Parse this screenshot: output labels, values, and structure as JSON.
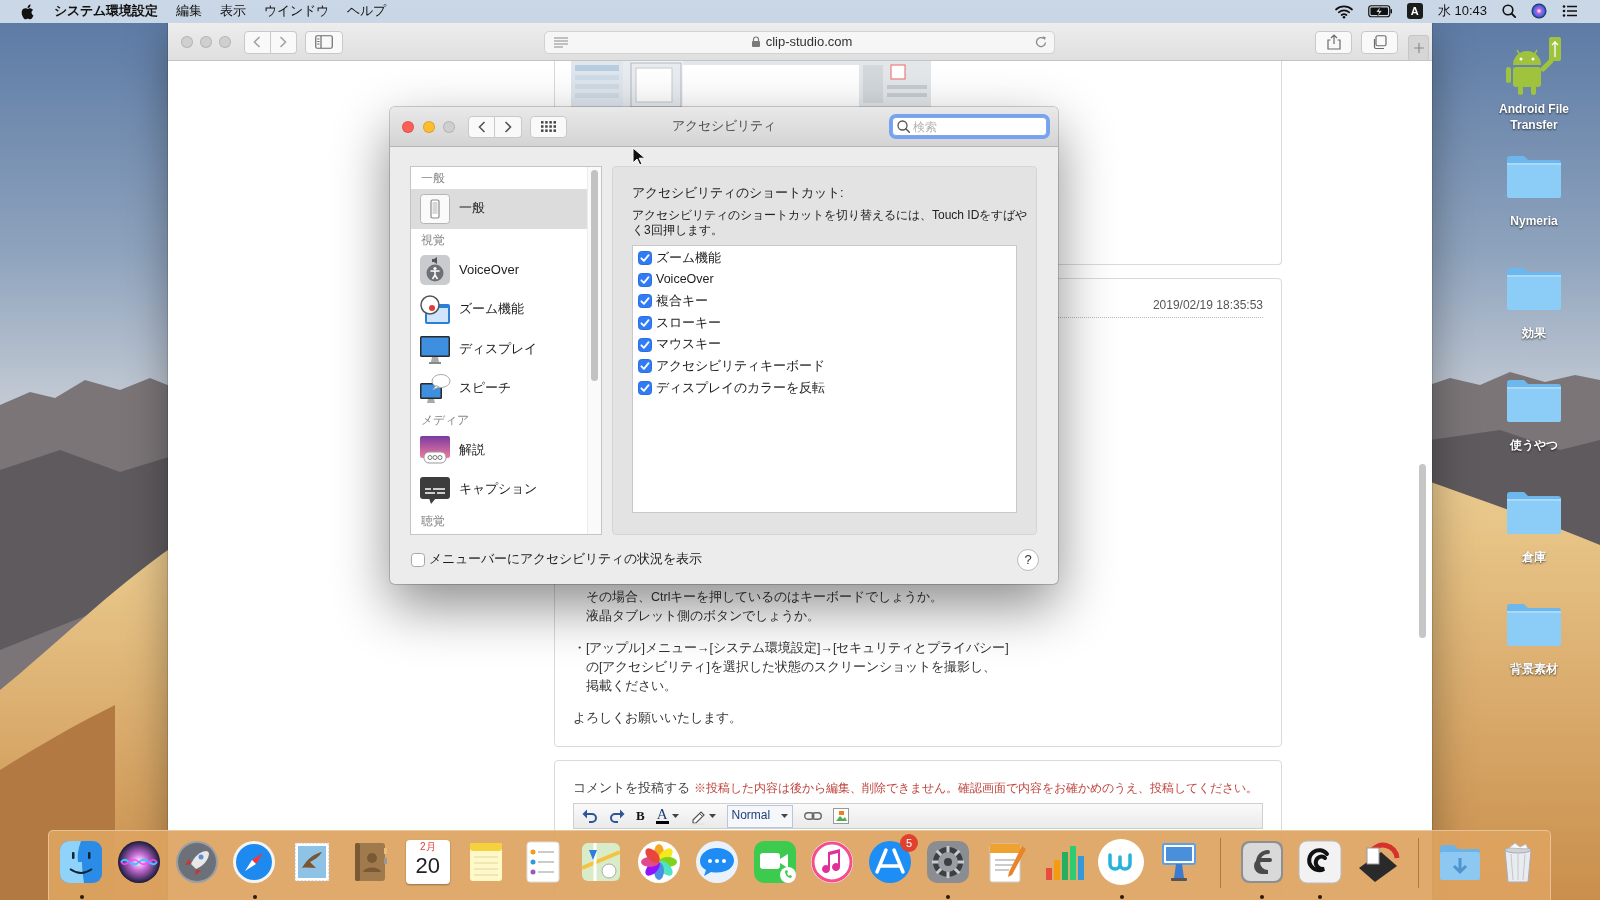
{
  "menu_bar": {
    "app_name": "システム環境設定",
    "menus": [
      "編集",
      "表示",
      "ウインドウ",
      "ヘルプ"
    ],
    "input_source": "A",
    "clock": "水 10:43"
  },
  "browser": {
    "active": false,
    "url": "clip-studio.com",
    "post": {
      "timestamp": "2019/02/19 18:35:53",
      "paragraphs": [
        [
          "　その場合、Ctrlキーを押しているのはキーボードでしょうか。",
          "　液晶タブレット側のボタンでしょうか。"
        ],
        [
          "・[アップル]メニュー→[システム環境設定]→[セキュリティとプライバシー]",
          "　の[アクセシビリティ]を選択した状態のスクリーンショットを撮影し、",
          "　掲載ください。"
        ],
        [
          "よろしくお願いいたします。"
        ]
      ]
    },
    "comment_form": {
      "title": "コメントを投稿する",
      "note": "※投稿した内容は後から編集、削除できません。確認画面で内容をお確かめのうえ、投稿してください。",
      "toolbar": {
        "bold": "B",
        "text_color": "A",
        "format": "Normal"
      }
    }
  },
  "preferences_window": {
    "active": true,
    "title": "アクセシビリティ",
    "search": {
      "placeholder": "検索",
      "focused": true
    },
    "sidebar": [
      {
        "header": "一般",
        "items": [
          {
            "label": "一般",
            "selected": true
          }
        ]
      },
      {
        "header": "視覚",
        "items": [
          {
            "label": "VoiceOver",
            "selected": false
          },
          {
            "label": "ズーム機能",
            "selected": false
          },
          {
            "label": "ディスプレイ",
            "selected": false
          },
          {
            "label": "スピーチ",
            "selected": false
          }
        ]
      },
      {
        "header": "メディア",
        "items": [
          {
            "label": "解説",
            "selected": false
          },
          {
            "label": "キャプション",
            "selected": false
          }
        ]
      },
      {
        "header": "聴覚"
      }
    ],
    "shortcuts": {
      "heading": "アクセシビリティのショートカット:",
      "description": "アクセシビリティのショートカットを切り替えるには、Touch IDをすばやく3回押します。",
      "items": [
        {
          "label": "ズーム機能",
          "checked": true
        },
        {
          "label": "VoiceOver",
          "checked": true
        },
        {
          "label": "複合キー",
          "checked": true
        },
        {
          "label": "スローキー",
          "checked": true
        },
        {
          "label": "マウスキー",
          "checked": true
        },
        {
          "label": "アクセシビリティキーボード",
          "checked": true
        },
        {
          "label": "ディスプレイのカラーを反転",
          "checked": true
        }
      ]
    },
    "status_checkbox": {
      "label": "メニューバーにアクセシビリティの状況を表示",
      "checked": false
    },
    "help_button": "?"
  },
  "desktop_icons": [
    {
      "kind": "app",
      "label": "Android File Transfer"
    },
    {
      "kind": "folder",
      "label": "Nymeria"
    },
    {
      "kind": "folder",
      "label": "効果"
    },
    {
      "kind": "folder",
      "label": "使うやつ"
    },
    {
      "kind": "folder",
      "label": "倉庫"
    },
    {
      "kind": "folder",
      "label": "背景素材"
    }
  ],
  "dock": {
    "sections": [
      {
        "items": [
          {
            "running": true
          },
          {
            "running": false
          },
          {
            "running": false
          },
          {
            "running": true
          },
          {
            "running": false
          },
          {
            "running": false
          },
          {
            "running": false,
            "month": "2月",
            "day": "20"
          },
          {
            "running": false
          },
          {
            "running": false
          },
          {
            "running": false
          },
          {
            "running": false
          },
          {
            "running": false
          },
          {
            "running": false
          },
          {
            "running": false
          },
          {
            "running": false,
            "badge": "5"
          },
          {
            "running": true
          },
          {
            "running": false
          },
          {
            "running": false
          },
          {
            "running": true
          },
          {
            "running": false
          }
        ]
      },
      {
        "items": [
          {
            "running": true
          },
          {
            "running": true
          },
          {
            "running": false
          }
        ]
      },
      {
        "items": [
          {
            "running": false
          },
          {
            "running": false
          }
        ]
      }
    ]
  }
}
